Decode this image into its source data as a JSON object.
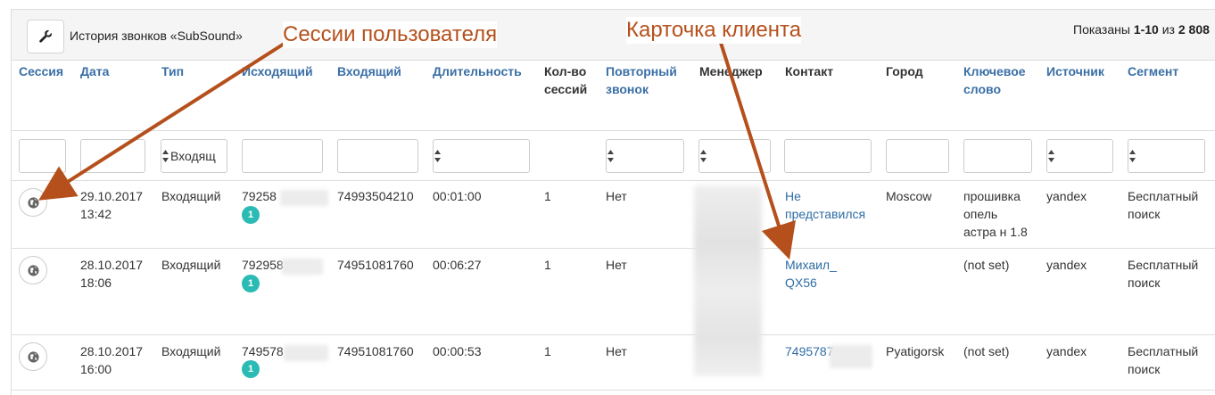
{
  "panel": {
    "title": "История звонков «SubSound»",
    "summary_prefix": "Показаны ",
    "summary_range": "1-10",
    "summary_mid": " из ",
    "summary_total": "2 808",
    "tool_icon": "wrench-icon"
  },
  "columns": [
    {
      "label": "Сессия",
      "line2": "",
      "sortable": true
    },
    {
      "label": "Дата",
      "line2": "",
      "sortable": true
    },
    {
      "label": "Тип",
      "line2": "",
      "sortable": true
    },
    {
      "label": "Исходящий",
      "line2": "",
      "sortable": true
    },
    {
      "label": "Входящий",
      "line2": "",
      "sortable": true
    },
    {
      "label": "Длительность",
      "line2": "",
      "sortable": true
    },
    {
      "label": "Кол-во",
      "line2": "сессий",
      "sortable": false
    },
    {
      "label": "Повторный",
      "line2": "звонок",
      "sortable": true
    },
    {
      "label": "Менеджер",
      "line2": "",
      "sortable": false
    },
    {
      "label": "Контакт",
      "line2": "",
      "sortable": false
    },
    {
      "label": "Город",
      "line2": "",
      "sortable": false
    },
    {
      "label": "Ключевое",
      "line2": "слово",
      "sortable": true
    },
    {
      "label": "Источник",
      "line2": "",
      "sortable": true
    },
    {
      "label": "Сегмент",
      "line2": "",
      "sortable": true
    }
  ],
  "filters": {
    "type_value": "Входящ"
  },
  "rows": [
    {
      "date": "29.10.2017",
      "time": "13:42",
      "type": "Входящий",
      "outgoing": "79258",
      "sessions_badge": "1",
      "incoming": "74993504210",
      "duration": "00:01:00",
      "sessions": "1",
      "repeat": "Нет",
      "contact_l1": "Не",
      "contact_l2": "представился",
      "city": "Moscow",
      "keyword_l1": "прошивка",
      "keyword_l2": "опель",
      "keyword_l3": "астра н 1.8",
      "source": "yandex",
      "segment_l1": "Бесплатный",
      "segment_l2": "поиск"
    },
    {
      "date": "28.10.2017",
      "time": "18:06",
      "type": "Входящий",
      "outgoing": "792958",
      "sessions_badge": "1",
      "incoming": "74951081760",
      "duration": "00:06:27",
      "sessions": "1",
      "repeat": "Нет",
      "contact_l1": "Михаил_",
      "contact_l2": "QX56",
      "city": "",
      "keyword_l1": "(not set)",
      "keyword_l2": "",
      "keyword_l3": "",
      "source": "yandex",
      "segment_l1": "Бесплатный",
      "segment_l2": "поиск"
    },
    {
      "date": "28.10.2017",
      "time": "16:00",
      "type": "Входящий",
      "outgoing": "749578",
      "sessions_badge": "1",
      "incoming": "74951081760",
      "duration": "00:00:53",
      "sessions": "1",
      "repeat": "Нет",
      "contact_l1": "7495787",
      "contact_l2": "",
      "city": "Pyatigorsk",
      "keyword_l1": "(not set)",
      "keyword_l2": "",
      "keyword_l3": "",
      "source": "yandex",
      "segment_l1": "Бесплатный",
      "segment_l2": "поиск"
    }
  ],
  "callouts": {
    "sessions": "Сессии пользователя",
    "card": "Карточка клиента"
  },
  "colors": {
    "link": "#3a6fa6",
    "badge": "#2bbbb4",
    "callout": "#b5501c"
  },
  "icons": {
    "session": "globe-icon",
    "select": "sort-arrows-icon"
  }
}
